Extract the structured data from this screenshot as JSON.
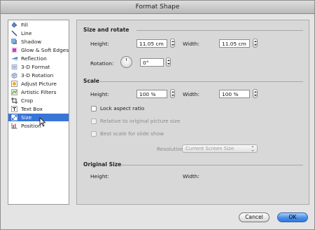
{
  "window": {
    "title": "Format Shape"
  },
  "sidebar": {
    "items": [
      {
        "label": "Fill",
        "icon": "fill-icon"
      },
      {
        "label": "Line",
        "icon": "line-icon"
      },
      {
        "label": "Shadow",
        "icon": "shadow-icon"
      },
      {
        "label": "Glow & Soft Edges",
        "icon": "glow-icon"
      },
      {
        "label": "Reflection",
        "icon": "reflection-icon"
      },
      {
        "label": "3-D Format",
        "icon": "3d-format-icon"
      },
      {
        "label": "3-D Rotation",
        "icon": "3d-rotation-icon"
      },
      {
        "label": "Adjust Picture",
        "icon": "adjust-picture-icon"
      },
      {
        "label": "Artistic Filters",
        "icon": "artistic-filters-icon"
      },
      {
        "label": "Crop",
        "icon": "crop-icon"
      },
      {
        "label": "Text Box",
        "icon": "text-box-icon"
      },
      {
        "label": "Size",
        "icon": "size-icon",
        "selected": true
      },
      {
        "label": "Position",
        "icon": "position-icon"
      }
    ]
  },
  "size_rotate": {
    "title": "Size and rotate",
    "height_label": "Height:",
    "height_value": "11.05 cm",
    "width_label": "Width:",
    "width_value": "11.05 cm",
    "rotation_label": "Rotation:",
    "rotation_value": "0°"
  },
  "scale": {
    "title": "Scale",
    "height_label": "Height:",
    "height_value": "100 %",
    "width_label": "Width:",
    "width_value": "100 %",
    "lock_aspect": "Lock aspect ratio",
    "relative_original": "Relative to original picture size",
    "best_scale": "Best scale for slide show",
    "resolution_label": "Resolution:",
    "resolution_value": "Current Screen Size"
  },
  "original_size": {
    "title": "Original Size",
    "height_label": "Height:",
    "width_label": "Width:"
  },
  "buttons": {
    "cancel": "Cancel",
    "ok": "OK"
  },
  "colors": {
    "selection": "#3875d7",
    "ok_button": "#4a8ee6"
  }
}
